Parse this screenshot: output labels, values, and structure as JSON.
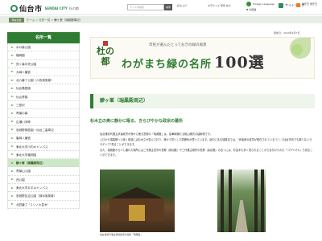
{
  "header": {
    "site_name": "仙台市",
    "site_tag": "SENDAI CITY",
    "site_tag2": "杜の都",
    "search_placeholder": "サイト内検索",
    "search_button": "検索",
    "links": [
      "読み上げ",
      "文字サイズ"
    ],
    "font_size_label": "文字サイズ 標準 拡大",
    "language_button": "Foreign Language",
    "language_sub": "▼ 外国語",
    "sitemap": "サイトマップ",
    "closed_days": "開庁日\n閉庁日"
  },
  "breadcrumb": {
    "tag": "現在位置",
    "items": [
      "ホーム",
      "名所一覧",
      "鯵ヶ峯（瑞鳳殿周辺）"
    ]
  },
  "sidebar": {
    "title": "名所一覧",
    "items": [
      "水の森公園",
      "榴岡園",
      "貝ヶ森中央公園",
      "大崎八幡宮",
      "北六番丁公園（六枚風風景）",
      "仙台藩庭園",
      "仙山界隈",
      "三居沢",
      "青葉の森",
      "広瀬川河畔",
      "宮城野原庭園・仙台二高周辺",
      "亀岡八幡宮",
      "東北大学川内キャンパス",
      "東北大学植物園",
      "鯵ヶ峯（瑞鳳殿周辺）",
      "青葉山公園",
      "西公園",
      "東北大学片平キャンパス",
      "宮城野区沼公園（緑水風風景）",
      "北四番丁 \"ユリノキ並木\""
    ],
    "active_index": 14
  },
  "main": {
    "updated": "更新日：2020年2月7日",
    "banner_sub": "市民が選んだとっておきの緑の風景",
    "banner_stamp": "杜の都",
    "banner_main": "わがまち緑の名所",
    "banner_num": "100選",
    "page_title": "鯵ヶ峯（瑞鳳殿周辺）",
    "subhead": "杉木立の奥に静かに眠る、きらびやかな政宗の墓所",
    "paragraphs": [
      "仙台藩初代藩主伊達政宗が静かに眠る霊屋の「瑞鳳殿」は、豪華絢爛たる桃山様式の建築物です。",
      "入口から瑞鳳殿へと続く参道には杉木立が並んでおり、静かで凛とした雰囲気が漂っています。途中にある瑞鳳寺では、\"伊達家の紋章が散在されている\"として仙台市内でも数少ないヨモギトウ\"見ることができます。",
      "また、瑞鳳殿から少し離れた場所には二代藩主忠宗の霊屋（感仙殿）や三代藩主綱宗の霊屋（善応殿）の近くには、杉並木も多く見られることから名付けられた「コウヤマキ」も見ることができます。"
    ],
    "photo_caption": "仙台藩初代藩主伊達政宗の霊屋「瑞鳳殿」"
  }
}
